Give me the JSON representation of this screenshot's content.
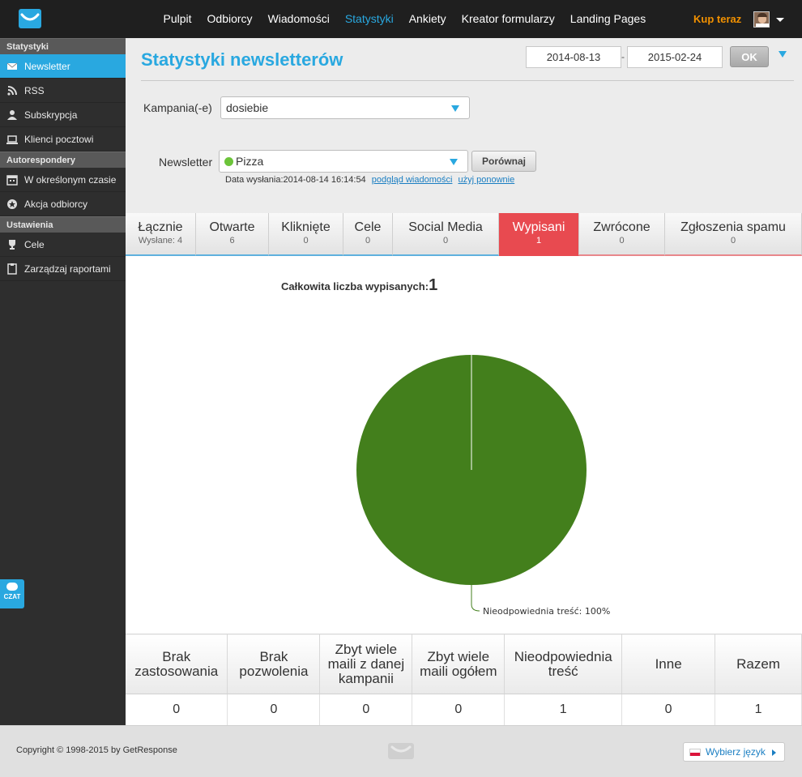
{
  "nav": {
    "items": [
      "Pulpit",
      "Odbiorcy",
      "Wiadomości",
      "Statystyki",
      "Ankiety",
      "Kreator formularzy",
      "Landing Pages"
    ],
    "active_index": 3,
    "buy_label": "Kup teraz"
  },
  "sidebar": {
    "sections": [
      {
        "title": "Statystyki",
        "items": [
          {
            "label": "Newsletter",
            "icon": "envelope-icon",
            "active": true
          },
          {
            "label": "RSS",
            "icon": "rss-icon"
          },
          {
            "label": "Subskrypcja",
            "icon": "user-icon"
          },
          {
            "label": "Klienci pocztowi",
            "icon": "laptop-icon"
          }
        ]
      },
      {
        "title": "Autorespondery",
        "items": [
          {
            "label": "W określonym czasie",
            "icon": "calendar-icon"
          },
          {
            "label": "Akcja odbiorcy",
            "icon": "star-badge-icon"
          }
        ]
      },
      {
        "title": "Ustawienia",
        "items": [
          {
            "label": "Cele",
            "icon": "trophy-icon"
          },
          {
            "label": "Zarządzaj raportami",
            "icon": "document-icon"
          }
        ]
      }
    ],
    "chat_label": "CZAT"
  },
  "header": {
    "title": "Statystyki newsletterów",
    "date_from": "2014-08-13",
    "date_separator": "-",
    "date_to": "2015-02-24",
    "ok_label": "OK"
  },
  "form": {
    "campaign_label": "Kampania(-e)",
    "campaign_value": "dosiebie",
    "newsletter_label": "Newsletter",
    "newsletter_value": "Pizza",
    "compare_label": "Porównaj",
    "sent_info": "Data wysłania:2014-08-14 16:14:54",
    "preview_link": "podgląd wiadomości",
    "reuse_link": "użyj ponownie"
  },
  "tabs": [
    {
      "label": "Łącznie",
      "value": "Wysłane: 4",
      "width": 87
    },
    {
      "label": "Otwarte",
      "value": "6",
      "width": 90
    },
    {
      "label": "Kliknięte",
      "value": "0",
      "width": 92
    },
    {
      "label": "Cele",
      "value": "0",
      "width": 61
    },
    {
      "label": "Social Media",
      "value": "0",
      "width": 131
    },
    {
      "label": "Wypisani",
      "value": "1",
      "width": 99,
      "active": true
    },
    {
      "label": "Zwrócone",
      "value": "0",
      "width": 106
    },
    {
      "label": "Zgłoszenia spamu",
      "value": "0",
      "width": 169
    }
  ],
  "chart_title_text": "Całkowita liczba wypisanych:",
  "chart_title_count": "1",
  "chart_data": {
    "type": "pie",
    "slices": [
      {
        "label": "Nieodpowiednia treść",
        "value": 100,
        "color": "#437f1c"
      }
    ],
    "data_labels": [
      "Nieodpowiednia treść: 100%"
    ]
  },
  "table": {
    "headers": [
      "Brak zastosowania",
      "Brak pozwolenia",
      "Zbyt wiele maili z danej kampanii",
      "Zbyt wiele maili ogółem",
      "Nieodpowiednia treść",
      "Inne",
      "Razem"
    ],
    "values": [
      "0",
      "0",
      "0",
      "0",
      "1",
      "0",
      "1"
    ]
  },
  "footer": {
    "copyright": "Copyright © 1998-2015 by GetResponse",
    "language_label": "Wybierz język"
  },
  "colors": {
    "accent": "#29a8e0",
    "buy": "#f29100",
    "active_tab": "#e84a50",
    "pie": "#437f1c"
  }
}
